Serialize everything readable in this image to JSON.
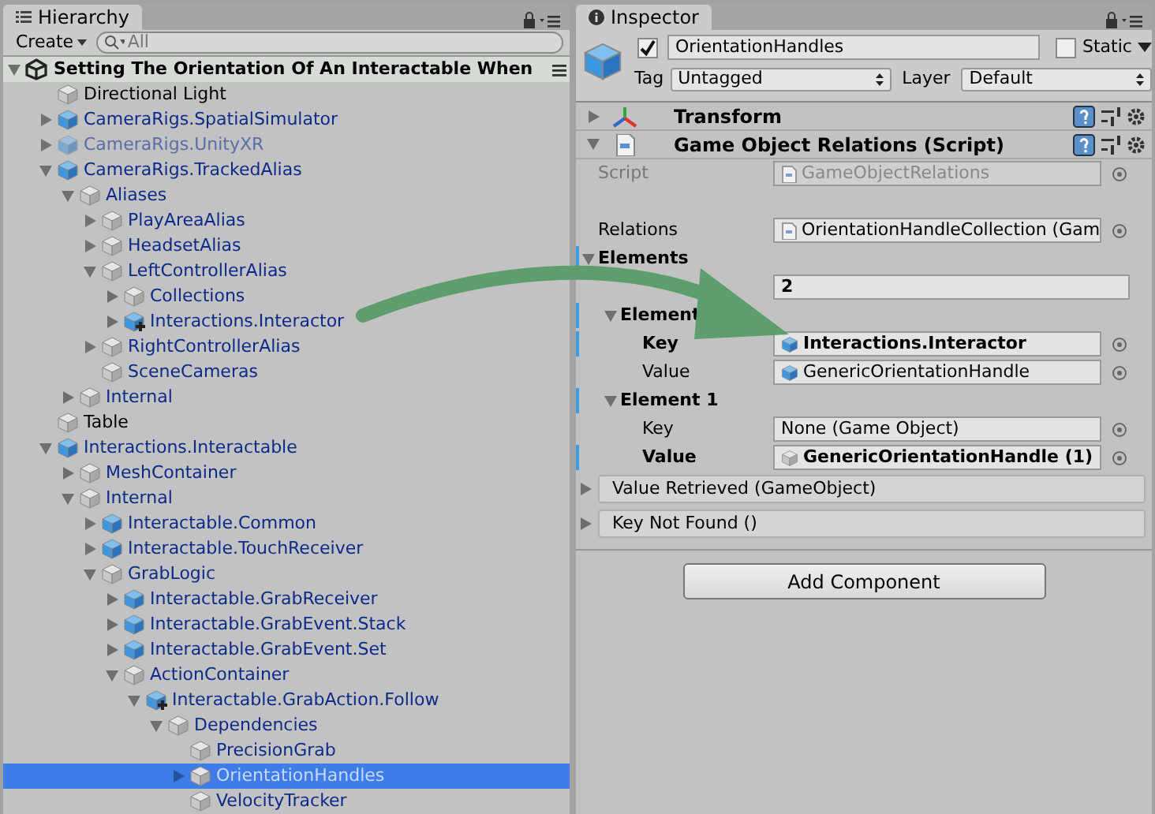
{
  "hierarchy": {
    "tab_title": "Hierarchy",
    "create_label": "Create",
    "search_placeholder": "All",
    "scene": {
      "title": "Setting The Orientation Of An Interactable When",
      "expanded": true
    },
    "items": [
      {
        "label": "Directional Light",
        "kind": "object",
        "disabled": false,
        "selected": false
      },
      {
        "label": "CameraRigs.SpatialSimulator",
        "kind": "prefab",
        "expanded": false,
        "disabled": false,
        "selected": false
      },
      {
        "label": "CameraRigs.UnityXR",
        "kind": "prefab",
        "expanded": false,
        "disabled": true,
        "selected": false
      },
      {
        "label": "CameraRigs.TrackedAlias",
        "kind": "prefab",
        "expanded": true,
        "disabled": false,
        "selected": false,
        "children": [
          {
            "label": "Aliases",
            "kind": "child",
            "expanded": true,
            "disabled": false,
            "selected": false,
            "children": [
              {
                "label": "PlayAreaAlias",
                "kind": "child",
                "expanded": false,
                "disabled": false,
                "selected": false
              },
              {
                "label": "HeadsetAlias",
                "kind": "child",
                "expanded": false,
                "disabled": false,
                "selected": false
              },
              {
                "label": "LeftControllerAlias",
                "kind": "child",
                "expanded": true,
                "disabled": false,
                "selected": false,
                "children": [
                  {
                    "label": "Collections",
                    "kind": "child",
                    "expanded": false,
                    "disabled": false,
                    "selected": false
                  },
                  {
                    "label": "Interactions.Interactor",
                    "kind": "added",
                    "expanded": false,
                    "disabled": false,
                    "selected": false
                  }
                ]
              },
              {
                "label": "RightControllerAlias",
                "kind": "child",
                "expanded": false,
                "disabled": false,
                "selected": false
              },
              {
                "label": "SceneCameras",
                "kind": "child",
                "disabled": false,
                "selected": false
              }
            ]
          },
          {
            "label": "Internal",
            "kind": "child",
            "expanded": false,
            "disabled": false,
            "selected": false
          }
        ]
      },
      {
        "label": "Table",
        "kind": "object",
        "disabled": false,
        "selected": false
      },
      {
        "label": "Interactions.Interactable",
        "kind": "prefab",
        "expanded": true,
        "disabled": false,
        "selected": false,
        "children": [
          {
            "label": "MeshContainer",
            "kind": "child",
            "expanded": false,
            "disabled": false,
            "selected": false
          },
          {
            "label": "Internal",
            "kind": "child",
            "expanded": true,
            "disabled": false,
            "selected": false,
            "children": [
              {
                "label": "Interactable.Common",
                "kind": "prefab",
                "expanded": false,
                "disabled": false,
                "selected": false
              },
              {
                "label": "Interactable.TouchReceiver",
                "kind": "prefab",
                "expanded": false,
                "disabled": false,
                "selected": false
              },
              {
                "label": "GrabLogic",
                "kind": "child",
                "expanded": true,
                "disabled": false,
                "selected": false,
                "children": [
                  {
                    "label": "Interactable.GrabReceiver",
                    "kind": "prefab",
                    "expanded": false,
                    "disabled": false,
                    "selected": false
                  },
                  {
                    "label": "Interactable.GrabEvent.Stack",
                    "kind": "prefab",
                    "expanded": false,
                    "disabled": false,
                    "selected": false
                  },
                  {
                    "label": "Interactable.GrabEvent.Set",
                    "kind": "prefab",
                    "expanded": false,
                    "disabled": false,
                    "selected": false
                  },
                  {
                    "label": "ActionContainer",
                    "kind": "child",
                    "expanded": true,
                    "disabled": false,
                    "selected": false,
                    "children": [
                      {
                        "label": "Interactable.GrabAction.Follow",
                        "kind": "added",
                        "expanded": true,
                        "disabled": false,
                        "selected": false,
                        "children": [
                          {
                            "label": "Dependencies",
                            "kind": "child",
                            "expanded": true,
                            "disabled": false,
                            "selected": false,
                            "children": [
                              {
                                "label": "PrecisionGrab",
                                "kind": "child",
                                "disabled": false,
                                "selected": false
                              },
                              {
                                "label": "OrientationHandles",
                                "kind": "child",
                                "expanded": false,
                                "disabled": false,
                                "selected": true
                              },
                              {
                                "label": "VelocityTracker",
                                "kind": "child",
                                "disabled": false,
                                "selected": false
                              }
                            ]
                          }
                        ]
                      }
                    ]
                  }
                ]
              }
            ]
          }
        ]
      }
    ]
  },
  "inspector": {
    "tab_title": "Inspector",
    "object": {
      "active": true,
      "name": "OrientationHandles",
      "static": false,
      "static_label": "Static",
      "tag_label": "Tag",
      "tag": "Untagged",
      "layer_label": "Layer",
      "layer": "Default"
    },
    "components": [
      {
        "title": "Transform",
        "kind": "transform",
        "expanded": false
      },
      {
        "title": "Game Object Relations (Script)",
        "kind": "script",
        "expanded": true
      }
    ],
    "properties": [
      {
        "kind": "script",
        "label": "Script",
        "value": "GameObjectRelations",
        "disabled": true,
        "overridden": false
      },
      {
        "kind": "spacer"
      },
      {
        "kind": "script",
        "label": "Relations",
        "value": "OrientationHandleCollection (Gam",
        "disabled": false,
        "overridden": false
      },
      {
        "kind": "foldout",
        "label": "Elements",
        "expanded": true,
        "overridden": true,
        "children": [
          {
            "kind": "number",
            "value": "2",
            "overridden": false
          },
          {
            "kind": "foldout",
            "label": "Element",
            "expanded": true,
            "overridden": true,
            "children": [
              {
                "kind": "prefab",
                "label": "Key",
                "value": "Interactions.Interactor",
                "disabled": false,
                "overridden": true
              },
              {
                "kind": "prefab",
                "label": "Value",
                "value": "GenericOrientationHandle",
                "disabled": false,
                "overridden": false
              }
            ]
          },
          {
            "kind": "foldout",
            "label": "Element 1",
            "expanded": true,
            "overridden": true,
            "children": [
              {
                "kind": "empty",
                "label": "Key",
                "value": "None (Game Object)",
                "disabled": false,
                "overridden": false
              },
              {
                "kind": "gameobject",
                "label": "Value",
                "value": "GenericOrientationHandle (1)",
                "disabled": false,
                "overridden": true
              }
            ]
          }
        ]
      }
    ],
    "events": [
      {
        "label": "Value Retrieved (GameObject)",
        "expanded": false
      },
      {
        "label": "Key Not Found ()",
        "expanded": false
      }
    ],
    "add_component": "Add Component"
  }
}
